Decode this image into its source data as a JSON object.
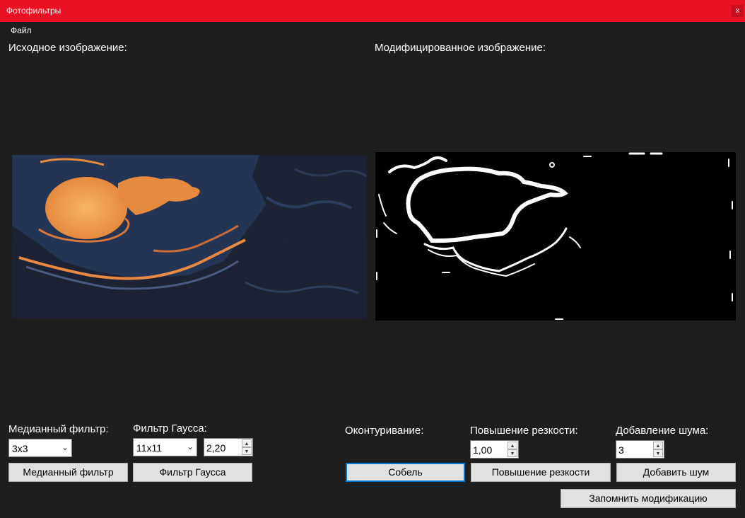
{
  "window": {
    "title": "Фотофильтры",
    "close_label": "x"
  },
  "menu": {
    "file": "Файл"
  },
  "panels": {
    "source_label": "Исходное изображение:",
    "modified_label": "Модифицированное изображение:"
  },
  "median": {
    "label": "Медианный фильтр:",
    "size_value": "3x3",
    "button": "Медианный фильтр"
  },
  "gauss": {
    "label": "Фильтр Гаусса:",
    "size_value": "11x11",
    "sigma_value": "2,20",
    "button": "Фильтр Гаусса"
  },
  "contour": {
    "label": "Оконтуривание:",
    "button": "Собель"
  },
  "sharpen": {
    "label": "Повышение резкости:",
    "value": "1,00",
    "button": "Повышение резкости"
  },
  "noise": {
    "label": "Добавление шума:",
    "value": "3",
    "button": "Добавить шум"
  },
  "save_button": "Запомнить модификацию",
  "colors": {
    "titlebar": "#e81123",
    "background": "#1e1e1e",
    "focus": "#0078d7"
  }
}
